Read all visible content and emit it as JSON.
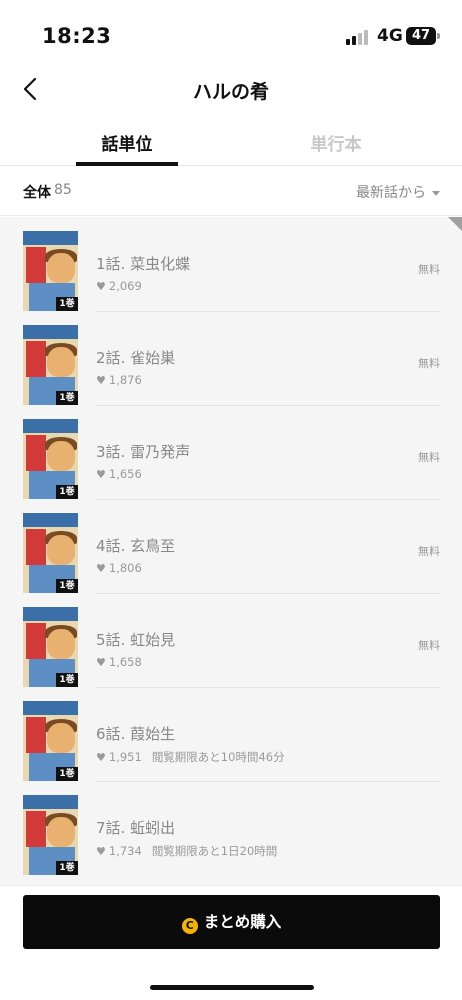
{
  "status_bar": {
    "time": "18:23",
    "network": "4G",
    "battery": "47"
  },
  "nav": {
    "title": "ハルの肴"
  },
  "tabs": [
    {
      "label": "話単位",
      "active": true
    },
    {
      "label": "単行本",
      "active": false
    }
  ],
  "filter": {
    "total_label": "全体",
    "total_count": "85",
    "sort_label": "最新話から"
  },
  "episodes": [
    {
      "title": "1話. 菜虫化蝶",
      "likes": "2,069",
      "badge": "無料",
      "volume": "1巻",
      "expiry": ""
    },
    {
      "title": "2話. 雀始巣",
      "likes": "1,876",
      "badge": "無料",
      "volume": "1巻",
      "expiry": ""
    },
    {
      "title": "3話. 雷乃発声",
      "likes": "1,656",
      "badge": "無料",
      "volume": "1巻",
      "expiry": ""
    },
    {
      "title": "4話. 玄鳥至",
      "likes": "1,806",
      "badge": "無料",
      "volume": "1巻",
      "expiry": ""
    },
    {
      "title": "5話. 虹始見",
      "likes": "1,658",
      "badge": "無料",
      "volume": "1巻",
      "expiry": ""
    },
    {
      "title": "6話. 葭始生",
      "likes": "1,951",
      "badge": "",
      "volume": "1巻",
      "expiry": "閲覧期限あと10時間46分"
    },
    {
      "title": "7話. 蚯蚓出",
      "likes": "1,734",
      "badge": "",
      "volume": "1巻",
      "expiry": "閲覧期限あと1日20時間"
    }
  ],
  "bottom": {
    "coin_icon": "C",
    "buy_label": "まとめ購入"
  },
  "colors": {
    "accent": "#0b0b0b",
    "coin": "#f4b400",
    "muted": "#9a9a9a",
    "list_bg": "#f5f5f5"
  }
}
